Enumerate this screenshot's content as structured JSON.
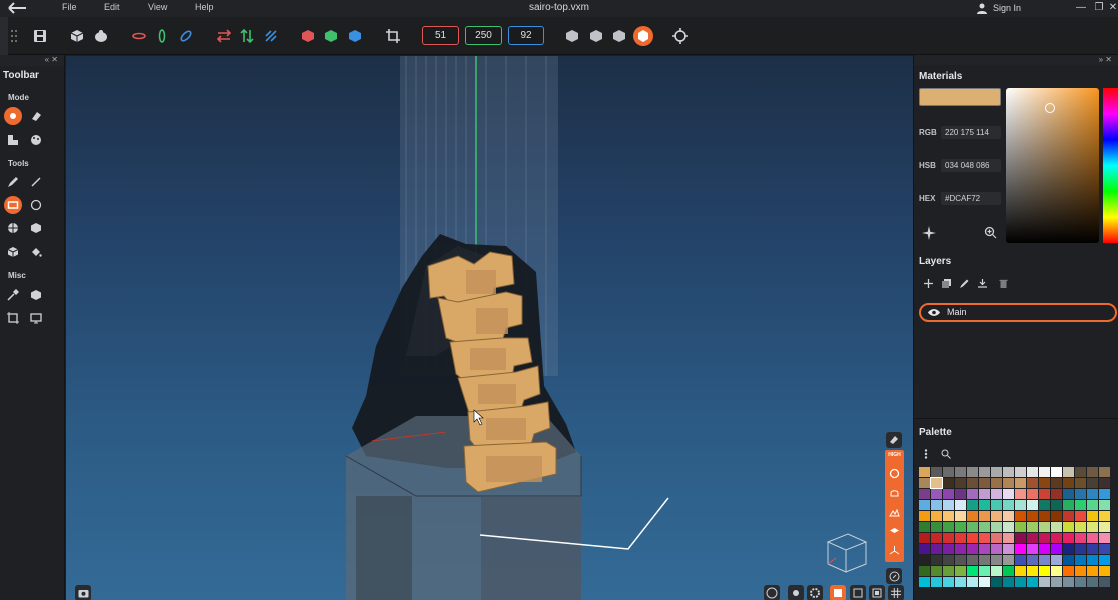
{
  "window": {
    "title": "sairo-top.vxm",
    "menu": [
      "File",
      "Edit",
      "View",
      "Help"
    ],
    "signin": "Sign In",
    "controls": [
      "—",
      "❐",
      "✕"
    ]
  },
  "toolbar": {
    "dimensions": [
      "51",
      "250",
      "92"
    ],
    "dimension_colors": [
      "#e05656",
      "#3ec06e",
      "#3a8fe0"
    ]
  },
  "left_panel": {
    "title": "Toolbar",
    "sections": [
      "Mode",
      "Tools",
      "Misc"
    ]
  },
  "materials": {
    "title": "Materials",
    "rgb_label": "RGB",
    "rgb_value": "220 175 114",
    "hsb_label": "HSB",
    "hsb_value": "034 048 086",
    "hex_label": "HEX",
    "hex_value": "#DCAF72",
    "color": "#DCAF72"
  },
  "layers": {
    "title": "Layers",
    "items": [
      {
        "name": "Main"
      }
    ]
  },
  "palette": {
    "title": "Palette",
    "colors": [
      "#d9a65b",
      "#5a5a5a",
      "#6b6b6b",
      "#7a7a7a",
      "#8a8a8a",
      "#9a9a9a",
      "#aaaaaa",
      "#bdbdbd",
      "#cfcfcf",
      "#e6e6e6",
      "#f2f2f2",
      "#ffffff",
      "#c8c3b0",
      "#5b4a3a",
      "#6e5a44",
      "#8c7050",
      "#a8875a",
      "#e3c08a",
      "#3d2e22",
      "#4d3b2c",
      "#6a4e36",
      "#7f5b3b",
      "#9a7048",
      "#b38556",
      "#c99a66",
      "#a0522d",
      "#8b4513",
      "#5c3a21",
      "#704214",
      "#6b4f2a",
      "#4a3f35",
      "#3b2f2f",
      "#7b3f8a",
      "#9b59b6",
      "#8e44ad",
      "#6c3483",
      "#a569bd",
      "#c39bd3",
      "#d2b4de",
      "#e8daef",
      "#f1948a",
      "#ec7063",
      "#cb4335",
      "#943126",
      "#1f618d",
      "#2874a6",
      "#2e86c1",
      "#3498db",
      "#5dade2",
      "#85c1e9",
      "#aed6f1",
      "#d6eaf8",
      "#16a085",
      "#1abc9c",
      "#48c9b0",
      "#76d7c4",
      "#a3e4d7",
      "#d1f2eb",
      "#117864",
      "#0e6655",
      "#27ae60",
      "#2ecc71",
      "#58d68d",
      "#82e0aa",
      "#f39c12",
      "#f5b041",
      "#f8c471",
      "#fad7a0",
      "#e67e22",
      "#eb984e",
      "#f0b27a",
      "#f5cba7",
      "#d35400",
      "#ba4a00",
      "#a04000",
      "#873600",
      "#c0392b",
      "#e74c3c",
      "#f1c40f",
      "#f4d03f",
      "#2e7d32",
      "#388e3c",
      "#43a047",
      "#4caf50",
      "#66bb6a",
      "#81c784",
      "#a5d6a7",
      "#c8e6c9",
      "#8bc34a",
      "#9ccc65",
      "#aed581",
      "#c5e1a5",
      "#cddc39",
      "#d4e157",
      "#dce775",
      "#e6ee9c",
      "#b71c1c",
      "#c62828",
      "#d32f2f",
      "#e53935",
      "#f44336",
      "#ef5350",
      "#e57373",
      "#ef9a9a",
      "#880e4f",
      "#ad1457",
      "#c2185b",
      "#d81b60",
      "#e91e63",
      "#ec407a",
      "#f06292",
      "#f48fb1",
      "#4a148c",
      "#6a1b9a",
      "#7b1fa2",
      "#8e24aa",
      "#9c27b0",
      "#ab47bc",
      "#ba68c8",
      "#ce93d8",
      "#ff00ff",
      "#e040fb",
      "#d500f9",
      "#aa00ff",
      "#1a237e",
      "#283593",
      "#303f9f",
      "#3949ab",
      "#222222",
      "#333333",
      "#444444",
      "#555555",
      "#666666",
      "#777777",
      "#888888",
      "#999999",
      "#3f51b5",
      "#5c6bc0",
      "#7986cb",
      "#9fa8da",
      "#01579b",
      "#0277bd",
      "#0288d1",
      "#039be5",
      "#33691e",
      "#558b2f",
      "#689f38",
      "#7cb342",
      "#00e676",
      "#69f0ae",
      "#b9f6ca",
      "#00c853",
      "#ffd600",
      "#ffea00",
      "#ffff00",
      "#ffff8d",
      "#ff6f00",
      "#ff8f00",
      "#ffa000",
      "#ffb300",
      "#00bcd4",
      "#26c6da",
      "#4dd0e1",
      "#80deea",
      "#b2ebf2",
      "#e0f7fa",
      "#006064",
      "#00838f",
      "#0097a7",
      "#00acc1",
      "#b0bec5",
      "#90a4ae",
      "#78909c",
      "#607d8b",
      "#546e7a",
      "#455a64"
    ]
  }
}
